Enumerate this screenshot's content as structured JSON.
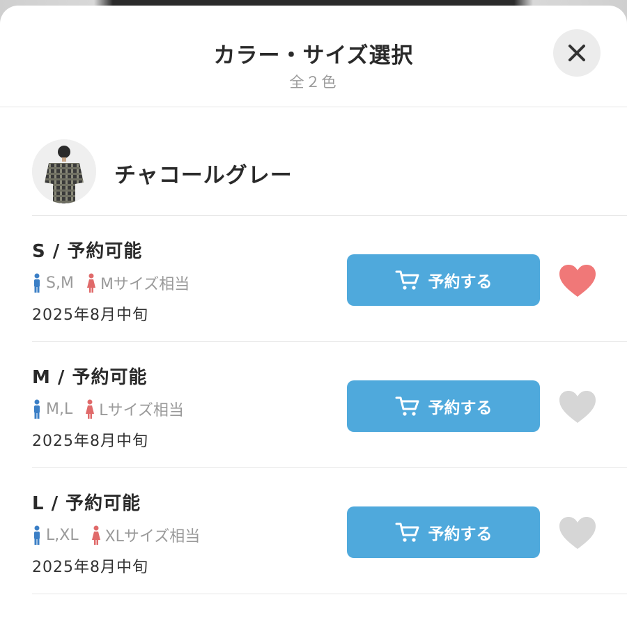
{
  "header": {
    "title": "カラー・サイズ選択",
    "subtitle": "全２色"
  },
  "color": {
    "name": "チャコールグレー"
  },
  "sizes": [
    {
      "heading": "S /  予約可能",
      "mens": "S,M",
      "womens": "Mサイズ相当",
      "date": "2025年8月中旬",
      "button": "予約する",
      "favorited": true
    },
    {
      "heading": "M /  予約可能",
      "mens": "M,L",
      "womens": "Lサイズ相当",
      "date": "2025年8月中旬",
      "button": "予約する",
      "favorited": false
    },
    {
      "heading": "L /  予約可能",
      "mens": "L,XL",
      "womens": "XLサイズ相当",
      "date": "2025年8月中旬",
      "button": "予約する",
      "favorited": false
    }
  ],
  "colors": {
    "accent": "#4fa9dc",
    "mens_icon": "#3b7fc6",
    "womens_icon": "#e06a6a",
    "fav_on": "#f07878",
    "fav_off": "#d6d6d6"
  },
  "icons": {
    "close": "close-icon",
    "cart": "cart-icon",
    "heart": "heart-icon",
    "mens": "male-person-icon",
    "womens": "female-person-icon"
  }
}
